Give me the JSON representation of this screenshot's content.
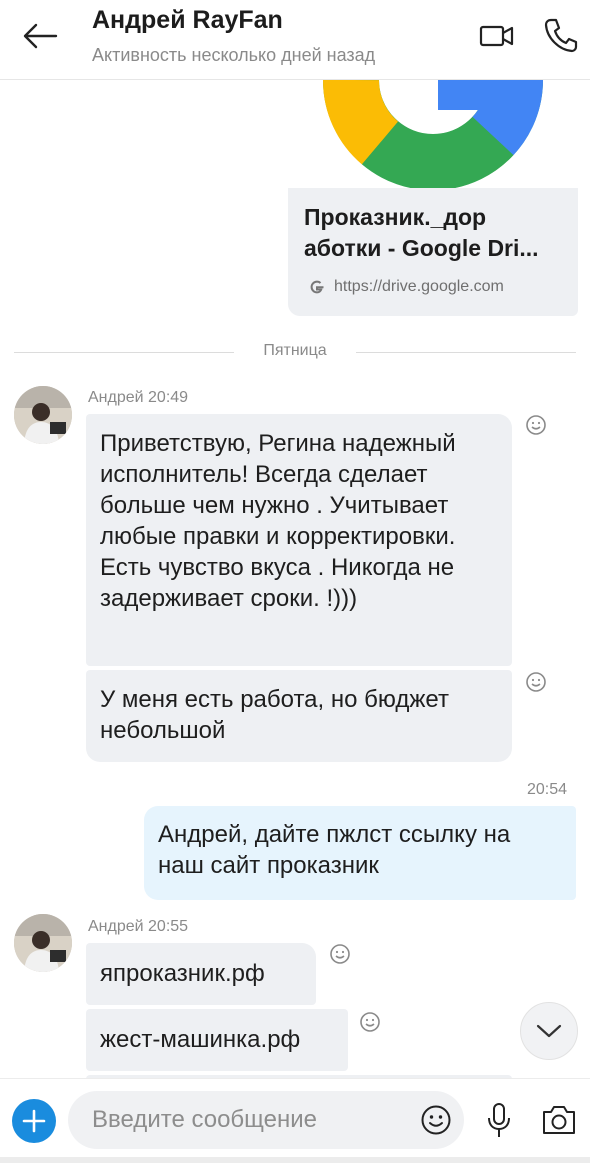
{
  "header": {
    "contact_name": "Андрей RayFan",
    "status": "Активность несколько дней назад",
    "back_icon": "arrow-left-icon",
    "video_icon": "video-camera-icon",
    "call_icon": "phone-icon"
  },
  "link_preview": {
    "title": "Проказник._дор аботки - Google Dri...",
    "url": "https://drive.google.com",
    "favicon": "google-g-icon",
    "thumbnail": "google-logo"
  },
  "date_separator": "Пятница",
  "groups": [
    {
      "sender": "Андрей 20:49",
      "messages": [
        "Приветствую, Регина надежный исполнитель! Всегда сделает больше чем нужно . Учитывает любые правки и корректировки. Есть чувство вкуса . Никогда не задерживает сроки. !)))",
        "У меня есть работа, но бюджет небольшой"
      ]
    },
    {
      "sender": "Андрей 20:55",
      "messages": [
        "япроказник.рф",
        "жест-машинка.рф"
      ]
    }
  ],
  "outgoing": {
    "time": "20:54",
    "text": "Андрей, дайте пжлст ссылку на наш сайт проказник"
  },
  "composer": {
    "placeholder": "Введите сообщение",
    "value": "",
    "add_icon": "plus-icon",
    "emoji_icon": "smiley-icon",
    "mic_icon": "microphone-icon",
    "camera_icon": "camera-icon"
  },
  "scroll_icon": "chevron-down-icon",
  "colors": {
    "accent": "#1a8cde",
    "incoming_bubble": "#eef0f3",
    "outgoing_bubble": "#e6f4fd"
  }
}
